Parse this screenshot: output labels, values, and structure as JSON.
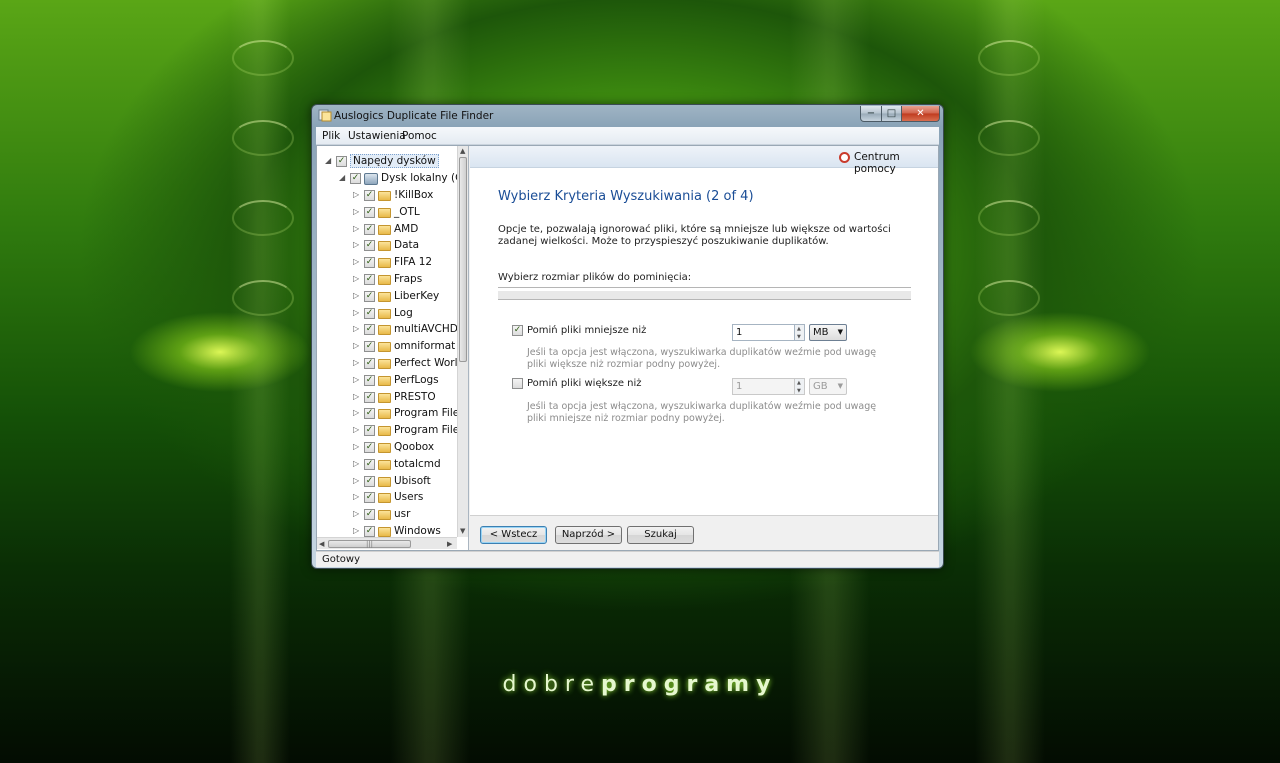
{
  "window": {
    "title": "Auslogics Duplicate File Finder",
    "minimize_glyph": "−",
    "maximize_glyph": "□",
    "close_glyph": "✕"
  },
  "menu": [
    "Plik",
    "Ustawienia",
    "Pomoc"
  ],
  "tree": {
    "root": "Napędy dysków",
    "drive": "Dysk lokalny (C:)",
    "folders": [
      "!KillBox",
      "_OTL",
      "AMD",
      "Data",
      "FIFA 12",
      "Fraps",
      "LiberKey",
      "Log",
      "multiAVCHD",
      "omniformat",
      "Perfect World Er",
      "PerfLogs",
      "PRESTO",
      "Program Files",
      "Program Files (x",
      "Qoobox",
      "totalcmd",
      "Ubisoft",
      "Users",
      "usr",
      "Windows"
    ],
    "check_mark": "✓",
    "collapse_glyph": "◢",
    "expand_glyph": "▷"
  },
  "help": {
    "label": "Centrum pomocy"
  },
  "wizard": {
    "title": "Wybierz Kryteria Wyszukiwania (2 of 4)",
    "description": "Opcje te, pozwalają ignorować pliki, które są mniejsze lub większe od wartości zadanej wielkości. Może to przyspieszyć poszukiwanie duplikatów.",
    "section_label": "Wybierz rozmiar plików do pominięcia:",
    "options": [
      {
        "label": "Pomiń pliki mniejsze niż",
        "checked": true,
        "value": "1",
        "unit": "MB",
        "enabled": true,
        "help": "Jeśli ta opcja jest włączona, wyszukiwarka duplikatów weźmie pod uwagę pliki większe niż rozmiar podny powyżej."
      },
      {
        "label": "Pomiń pliki większe niż",
        "checked": false,
        "value": "1",
        "unit": "GB",
        "enabled": false,
        "help": "Jeśli ta opcja jest włączona, wyszukiwarka duplikatów weźmie pod uwagę pliki mniejsze niż rozmiar podny powyżej."
      }
    ]
  },
  "buttons": {
    "back": "< Wstecz",
    "next": "Naprzód >",
    "search": "Szukaj"
  },
  "status": "Gotowy",
  "brand": {
    "part1": "dobre",
    "part2": "programy"
  },
  "colors": {
    "accent_blue": "#1a4d96",
    "help_red": "#c93b2c",
    "brand_glow": "#aaff3c"
  }
}
